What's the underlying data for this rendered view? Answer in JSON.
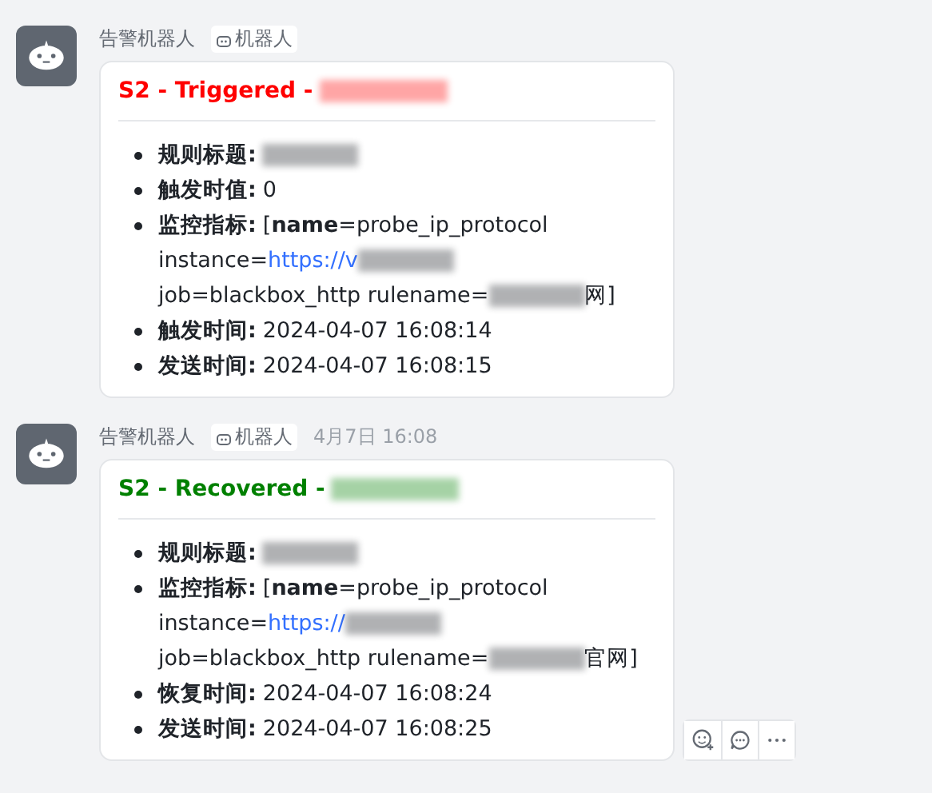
{
  "messages": [
    {
      "sender": "告警机器人",
      "badge": "机器人",
      "kind": "triggered",
      "title": "S2 - Triggered -",
      "fields": [
        {
          "label": "规则标题:",
          "lines": [
            [
              {
                "kind": "redacted"
              }
            ]
          ]
        },
        {
          "label": "触发时值:",
          "lines": [
            [
              {
                "kind": "text",
                "text": "0"
              }
            ]
          ]
        },
        {
          "label": "监控指标:",
          "lines": [
            [
              {
                "kind": "text",
                "text": "[**name**=probe_ip_protocol"
              }
            ],
            [
              {
                "kind": "text",
                "text": "instance="
              },
              {
                "kind": "link",
                "text": "https://v"
              },
              {
                "kind": "redacted"
              }
            ],
            [
              {
                "kind": "text",
                "text": "job=blackbox_http rulename="
              },
              {
                "kind": "redacted"
              },
              {
                "kind": "text",
                "text": "网]"
              }
            ]
          ]
        },
        {
          "label": "触发时间:",
          "lines": [
            [
              {
                "kind": "text",
                "text": "2024-04-07 16:08:14"
              }
            ]
          ]
        },
        {
          "label": "发送时间:",
          "lines": [
            [
              {
                "kind": "text",
                "text": "2024-04-07 16:08:15"
              }
            ]
          ]
        }
      ]
    },
    {
      "sender": "告警机器人",
      "badge": "机器人",
      "time": "4月7日 16:08",
      "kind": "recovered",
      "title": "S2 - Recovered -",
      "actions": true,
      "fields": [
        {
          "label": "规则标题:",
          "lines": [
            [
              {
                "kind": "redacted"
              }
            ]
          ]
        },
        {
          "label": "监控指标:",
          "lines": [
            [
              {
                "kind": "text",
                "text": "[**name**=probe_ip_protocol"
              }
            ],
            [
              {
                "kind": "text",
                "text": "instance="
              },
              {
                "kind": "link",
                "text": "https://"
              },
              {
                "kind": "redacted"
              }
            ],
            [
              {
                "kind": "text",
                "text": "job=blackbox_http rulename="
              },
              {
                "kind": "redacted"
              },
              {
                "kind": "text",
                "text": "官网]"
              }
            ]
          ]
        },
        {
          "label": "恢复时间:",
          "lines": [
            [
              {
                "kind": "text",
                "text": "2024-04-07 16:08:24"
              }
            ]
          ]
        },
        {
          "label": "发送时间:",
          "lines": [
            [
              {
                "kind": "text",
                "text": "2024-04-07 16:08:25"
              }
            ]
          ]
        }
      ]
    }
  ]
}
